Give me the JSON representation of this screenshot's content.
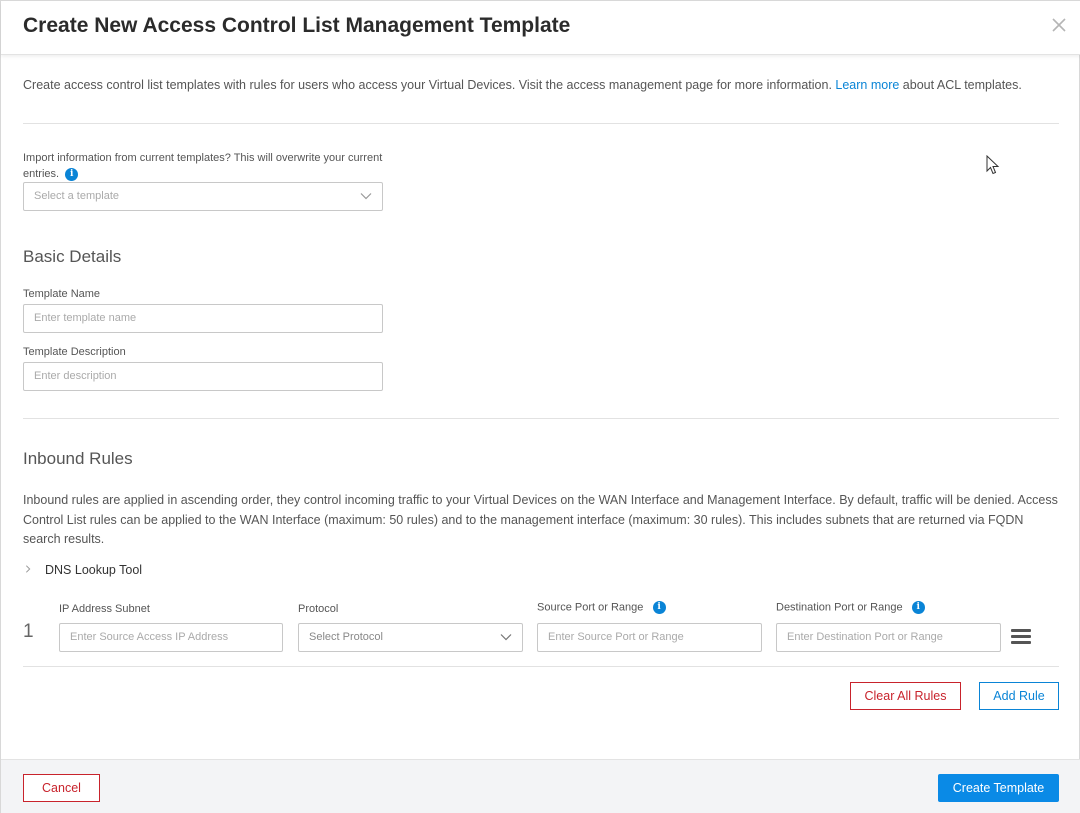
{
  "modal": {
    "title": "Create New Access Control List Management Template",
    "close_icon": "close-icon"
  },
  "intro": {
    "text_before": "Create access control list templates with rules for users who access your Virtual Devices. Visit the access management page for more information. ",
    "link": "Learn more",
    "text_after": " about ACL templates."
  },
  "import": {
    "label_line1": "Import information from current templates? This will overwrite your current",
    "label_line2": "entries.",
    "info_icon": "info-icon",
    "placeholder": "Select a template"
  },
  "basic_details": {
    "heading": "Basic Details",
    "name_label": "Template Name",
    "name_placeholder": "Enter template name",
    "desc_label": "Template Description",
    "desc_placeholder": "Enter description"
  },
  "inbound": {
    "heading": "Inbound Rules",
    "description": "Inbound rules are applied in ascending order, they control incoming traffic to your Virtual Devices on the WAN Interface and Management Interface. By default, traffic will be denied. Access Control List rules can be applied to the WAN Interface (maximum: 50 rules) and to the management interface (maximum: 30 rules). This includes subnets that are returned via FQDN search results.",
    "dns_tool": "DNS Lookup Tool",
    "columns": {
      "ip": "IP Address Subnet",
      "protocol": "Protocol",
      "source_port": "Source Port or Range",
      "dest_port": "Destination Port or Range"
    },
    "rows": [
      {
        "number": "1",
        "ip_placeholder": "Enter Source Access IP Address",
        "protocol_placeholder": "Select Protocol",
        "source_placeholder": "Enter Source Port or Range",
        "dest_placeholder": "Enter Destination Port or Range"
      }
    ],
    "clear_all": "Clear All Rules",
    "add_rule": "Add Rule"
  },
  "footer": {
    "cancel": "Cancel",
    "create": "Create Template"
  },
  "colors": {
    "accent": "#0a84d6",
    "danger": "#c8232c"
  }
}
